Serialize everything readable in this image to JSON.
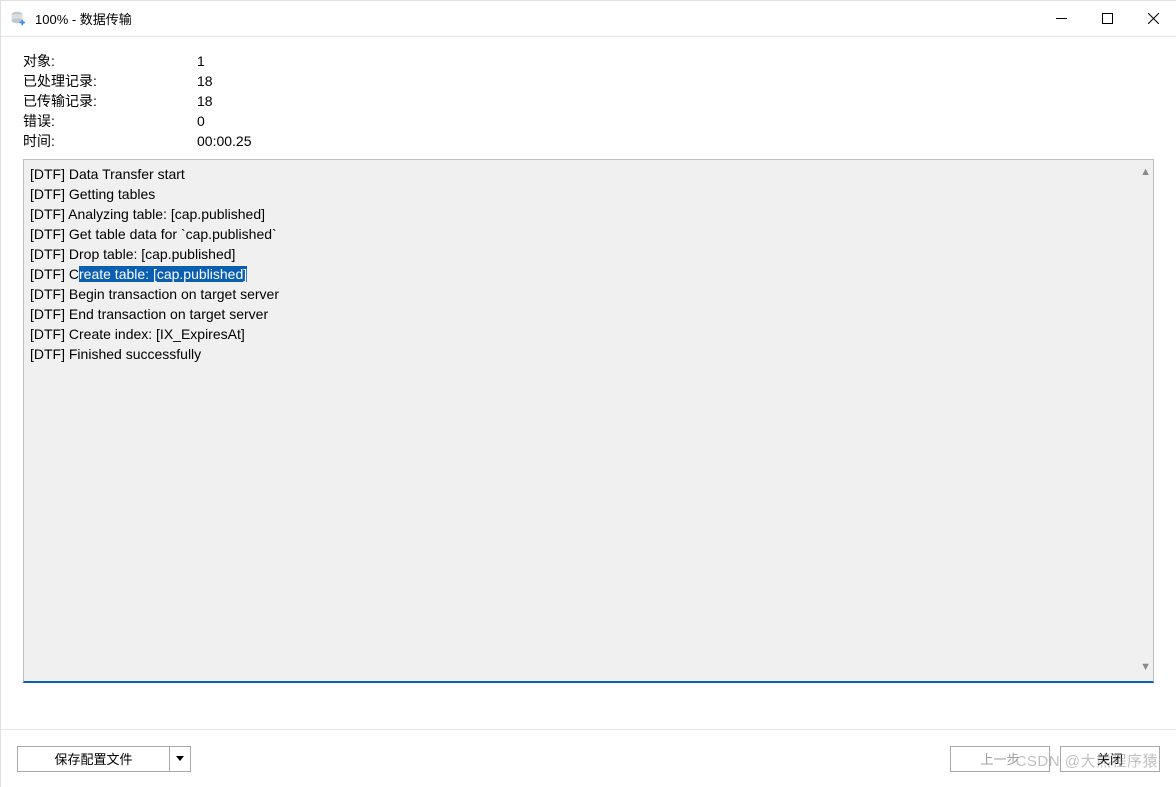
{
  "window": {
    "title": "100% - 数据传输"
  },
  "stats": {
    "rows": [
      {
        "label": "对象:",
        "value": "1"
      },
      {
        "label": "已处理记录:",
        "value": "18"
      },
      {
        "label": "已传输记录:",
        "value": "18"
      },
      {
        "label": "错误:",
        "value": "0"
      },
      {
        "label": "时间:",
        "value": "00:00.25"
      }
    ]
  },
  "log": {
    "lines": [
      {
        "pre": "[DTF] Data Transfer start",
        "sel": "",
        "post": ""
      },
      {
        "pre": "[DTF] Getting tables",
        "sel": "",
        "post": ""
      },
      {
        "pre": "[DTF] Analyzing table: [cap.published]",
        "sel": "",
        "post": ""
      },
      {
        "pre": "[DTF] Get table data for `cap.published`",
        "sel": "",
        "post": ""
      },
      {
        "pre": "[DTF] Drop table: [cap.published]",
        "sel": "",
        "post": ""
      },
      {
        "pre": "[DTF] C",
        "sel": "reate table: [cap.published]",
        "post": ""
      },
      {
        "pre": "[DTF] Begin transaction on target server",
        "sel": "",
        "post": ""
      },
      {
        "pre": "[DTF] End transaction on target server",
        "sel": "",
        "post": ""
      },
      {
        "pre": "[DTF] Create index: [IX_ExpiresAt]",
        "sel": "",
        "post": ""
      },
      {
        "pre": "[DTF] Finished successfully",
        "sel": "",
        "post": ""
      }
    ]
  },
  "footer": {
    "save_label": "保存配置文件",
    "prev_label": "上一步",
    "close_label": "关闭"
  },
  "watermark": "CSDN @大熊程序猿"
}
